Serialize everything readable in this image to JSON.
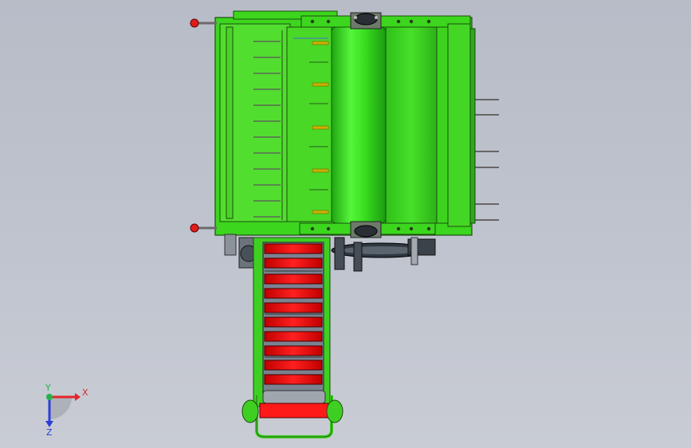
{
  "viewport": {
    "background_top": "#b7bcc7",
    "background_bottom": "#c9ccd4"
  },
  "model": {
    "frame_color": "#3cd61e",
    "frame_edge": "#1a4d0e",
    "roller_color": "#39e624",
    "belt_color": "#ff1a1a",
    "handle_color": "#e01b1b",
    "steel_color": "#9aa0a6"
  },
  "triad": {
    "x_label": "X",
    "y_label": "Y",
    "z_label": "Z",
    "x_color": "#e3262b",
    "y_color": "#22b24c",
    "z_color": "#2b3fd6"
  }
}
